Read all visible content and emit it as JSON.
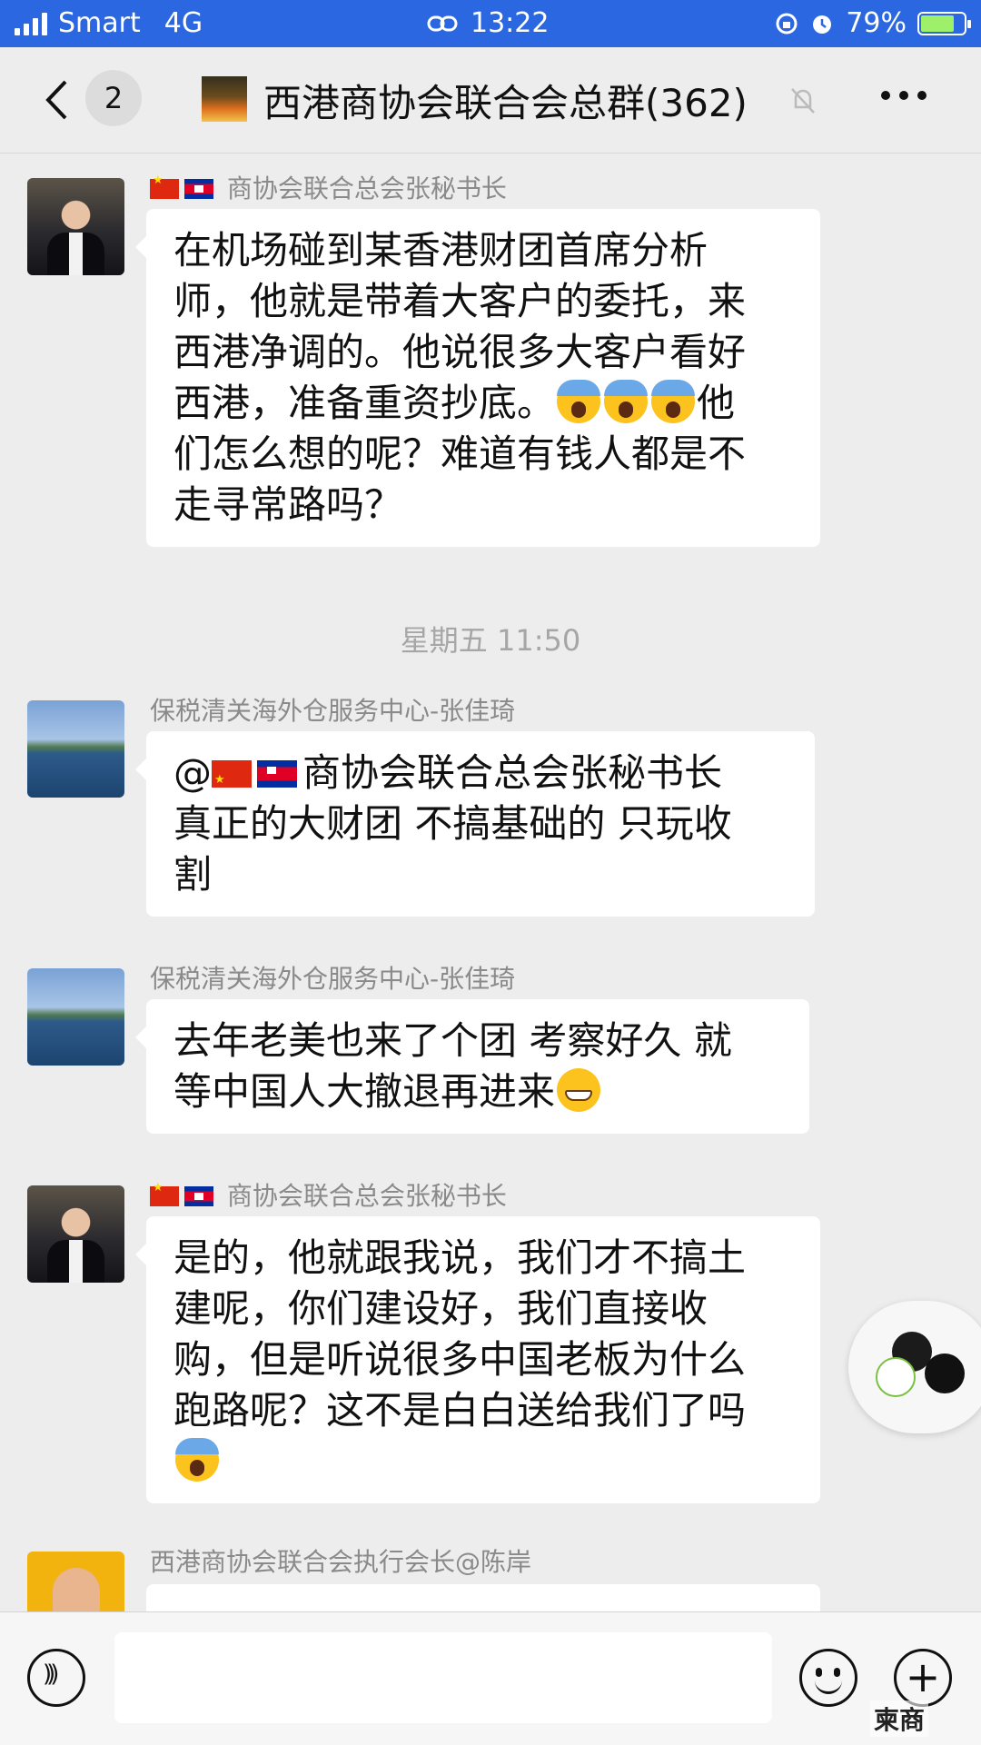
{
  "status_bar": {
    "carrier": "Smart",
    "network": "4G",
    "time": "13:22",
    "battery_percent": "79%",
    "battery_level": 0.79,
    "battery_fill_color": "#9ef06b",
    "background_color": "#2a67e0"
  },
  "nav": {
    "unread_count": "2",
    "title": "西港商协会联合会总群(362)"
  },
  "messages": [
    {
      "sender": "商协会联合总会张秘书长",
      "lines": [
        "在机场碰到某香港财团首席分析",
        "师，他就是带着大客户的委托，来",
        "西港净调的。他说很多大客户看好",
        "西港，准备重资抄底。",
        "们怎么想的呢？难道有钱人都是不",
        "走寻常路吗？"
      ],
      "line4_suffix": "他"
    },
    {
      "sender": "保税清关海外仓服务中心-张佳琦",
      "mention_prefix": "@",
      "lines": [
        "商协会联合总会张秘书长",
        "真正的大财团 不搞基础的 只玩收",
        "割"
      ]
    },
    {
      "sender": "保税清关海外仓服务中心-张佳琦",
      "lines": [
        "去年老美也来了个团 考察好久  就",
        "等中国人大撤退再进来"
      ]
    },
    {
      "sender": "商协会联合总会张秘书长",
      "lines": [
        "是的，他就跟我说，我们才不搞土",
        "建呢，你们建设好，我们直接收",
        "购，但是听说很多中国老板为什么",
        "跑路呢？这不是白白送给我们了吗"
      ]
    },
    {
      "sender": "西港商协会联合会执行会长@陈岸"
    }
  ],
  "timestamp": "星期五 11:50",
  "watermark": "柬商",
  "icons": {
    "back": "chevron-left-icon",
    "mute": "bell-slash-icon",
    "more": "more-dots-icon",
    "voice": "voice-icon",
    "emoji": "emoji-icon",
    "plus": "plus-icon"
  }
}
